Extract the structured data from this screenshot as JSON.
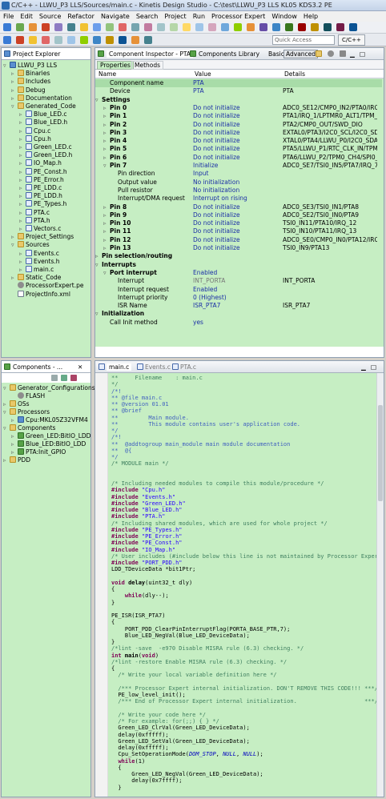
{
  "window": {
    "title": "C/C++ - LLWU_P3 LLS/Sources/main.c - Kinetis Design Studio - C:\\test\\LLWU_P3 LLS KL05 KDS3.2 PE"
  },
  "menu": [
    "File",
    "Edit",
    "Source",
    "Refactor",
    "Navigate",
    "Search",
    "Project",
    "Run",
    "Processor Expert",
    "Window",
    "Help"
  ],
  "toolbar": {
    "quick_access_placeholder": "Quick Access",
    "perspective": "C/C++"
  },
  "project_explorer": {
    "tab_label": "Project Explorer",
    "items": [
      {
        "label": "LLWU_P3 LLS",
        "icon": "project-icon",
        "depth": 0,
        "twisty": "▿"
      },
      {
        "label": "Binaries",
        "icon": "folder-icon",
        "depth": 1,
        "twisty": "▹"
      },
      {
        "label": "Includes",
        "icon": "folder-icon",
        "depth": 1,
        "twisty": "▹"
      },
      {
        "label": "Debug",
        "icon": "folder-icon",
        "depth": 1,
        "twisty": "▹"
      },
      {
        "label": "Documentation",
        "icon": "folder-icon",
        "depth": 1,
        "twisty": "▹"
      },
      {
        "label": "Generated_Code",
        "icon": "folder-icon",
        "depth": 1,
        "twisty": "▿"
      },
      {
        "label": "Blue_LED.c",
        "icon": "c-file-icon",
        "depth": 2,
        "twisty": "▹"
      },
      {
        "label": "Blue_LED.h",
        "icon": "c-file-icon",
        "depth": 2,
        "twisty": "▹"
      },
      {
        "label": "Cpu.c",
        "icon": "c-file-icon",
        "depth": 2,
        "twisty": "▹"
      },
      {
        "label": "Cpu.h",
        "icon": "c-file-icon",
        "depth": 2,
        "twisty": "▹"
      },
      {
        "label": "Green_LED.c",
        "icon": "c-file-icon",
        "depth": 2,
        "twisty": "▹"
      },
      {
        "label": "Green_LED.h",
        "icon": "c-file-icon",
        "depth": 2,
        "twisty": "▹"
      },
      {
        "label": "IO_Map.h",
        "icon": "c-file-icon",
        "depth": 2,
        "twisty": "▹"
      },
      {
        "label": "PE_Const.h",
        "icon": "c-file-icon",
        "depth": 2,
        "twisty": "▹"
      },
      {
        "label": "PE_Error.h",
        "icon": "c-file-icon",
        "depth": 2,
        "twisty": "▹"
      },
      {
        "label": "PE_LDD.c",
        "icon": "c-file-icon",
        "depth": 2,
        "twisty": "▹"
      },
      {
        "label": "PE_LDD.h",
        "icon": "c-file-icon",
        "depth": 2,
        "twisty": "▹"
      },
      {
        "label": "PE_Types.h",
        "icon": "c-file-icon",
        "depth": 2,
        "twisty": "▹"
      },
      {
        "label": "PTA.c",
        "icon": "c-file-icon",
        "depth": 2,
        "twisty": "▹"
      },
      {
        "label": "PTA.h",
        "icon": "c-file-icon",
        "depth": 2,
        "twisty": "▹"
      },
      {
        "label": "Vectors.c",
        "icon": "c-file-icon",
        "depth": 2,
        "twisty": "▹"
      },
      {
        "label": "Project_Settings",
        "icon": "folder-icon",
        "depth": 1,
        "twisty": "▹"
      },
      {
        "label": "Sources",
        "icon": "folder-icon",
        "depth": 1,
        "twisty": "▿"
      },
      {
        "label": "Events.c",
        "icon": "c-file-icon",
        "depth": 2,
        "twisty": "▹"
      },
      {
        "label": "Events.h",
        "icon": "c-file-icon",
        "depth": 2,
        "twisty": "▹"
      },
      {
        "label": "main.c",
        "icon": "c-file-icon",
        "depth": 2,
        "twisty": "▹"
      },
      {
        "label": "Static_Code",
        "icon": "folder-icon",
        "depth": 1,
        "twisty": "▹"
      },
      {
        "label": "ProcessorExpert.pe",
        "icon": "gear-icon",
        "depth": 1,
        "twisty": ""
      },
      {
        "label": "ProjectInfo.xml",
        "icon": "file-icon",
        "depth": 1,
        "twisty": ""
      }
    ]
  },
  "component_inspector": {
    "tab_label": "Component Inspector - PTA",
    "tab2_label": "Components Library",
    "mode_basic": "Basic",
    "mode_advanced": "Advanced",
    "subtabs": [
      "Properties",
      "Methods"
    ],
    "headers": [
      "Name",
      "Value",
      "Details"
    ],
    "rows": [
      {
        "name": "Component name",
        "value": "PTA",
        "details": "",
        "indent": 1,
        "twisty": "",
        "bold": false
      },
      {
        "name": "Device",
        "value": "PTA",
        "details": "PTA",
        "indent": 1,
        "twisty": "",
        "bold": false
      },
      {
        "name": "Settings",
        "value": "",
        "details": "",
        "indent": 0,
        "twisty": "▿",
        "bold": true
      },
      {
        "name": "Pin 0",
        "value": "Do not initialize",
        "details": "ADC0_SE12/CMP0_IN2/PTA0/IRQ_...",
        "indent": 1,
        "twisty": "▹",
        "bold": true
      },
      {
        "name": "Pin 1",
        "value": "Do not initialize",
        "details": "PTA1/IRQ_1/LPTMR0_ALT1/TPM_...",
        "indent": 1,
        "twisty": "▹",
        "bold": true
      },
      {
        "name": "Pin 2",
        "value": "Do not initialize",
        "details": "PTA2/CMP0_OUT/SWD_DIO",
        "indent": 1,
        "twisty": "▹",
        "bold": true
      },
      {
        "name": "Pin 3",
        "value": "Do not initialize",
        "details": "EXTAL0/PTA3/I2C0_SCL/I2C0_SDA",
        "indent": 1,
        "twisty": "▹",
        "bold": true
      },
      {
        "name": "Pin 4",
        "value": "Do not initialize",
        "details": "XTAL0/PTA4/LLWU_P0/I2C0_SDA/...",
        "indent": 1,
        "twisty": "▹",
        "bold": true
      },
      {
        "name": "Pin 5",
        "value": "Do not initialize",
        "details": "PTA5/LLWU_P1/RTC_CLK_IN/TPM...",
        "indent": 1,
        "twisty": "▹",
        "bold": true
      },
      {
        "name": "Pin 6",
        "value": "Do not initialize",
        "details": "PTA6/LLWU_P2/TPM0_CH4/SPI0_...",
        "indent": 1,
        "twisty": "▹",
        "bold": true
      },
      {
        "name": "Pin 7",
        "value": "Initialize",
        "details": "ADC0_SE7/TSI0_IN5/PTA7/IRQ_7/L...",
        "indent": 1,
        "twisty": "▿",
        "bold": true
      },
      {
        "name": "Pin direction",
        "value": "Input",
        "details": "",
        "indent": 2,
        "twisty": "",
        "bold": false
      },
      {
        "name": "Output value",
        "value": "No initialization",
        "details": "",
        "indent": 2,
        "twisty": "",
        "bold": false
      },
      {
        "name": "Pull resistor",
        "value": "No initialization",
        "details": "",
        "indent": 2,
        "twisty": "",
        "bold": false
      },
      {
        "name": "Interrupt/DMA request",
        "value": "Interrupt on rising",
        "details": "",
        "indent": 2,
        "twisty": "",
        "bold": false
      },
      {
        "name": "Pin 8",
        "value": "Do not initialize",
        "details": "ADC0_SE3/TSI0_IN1/PTA8",
        "indent": 1,
        "twisty": "▹",
        "bold": true
      },
      {
        "name": "Pin 9",
        "value": "Do not initialize",
        "details": "ADC0_SE2/TSI0_IN0/PTA9",
        "indent": 1,
        "twisty": "▹",
        "bold": true
      },
      {
        "name": "Pin 10",
        "value": "Do not initialize",
        "details": "TSI0_IN11/PTA10/IRQ_12",
        "indent": 1,
        "twisty": "▹",
        "bold": true
      },
      {
        "name": "Pin 11",
        "value": "Do not initialize",
        "details": "TSI0_IN10/PTA11/IRQ_13",
        "indent": 1,
        "twisty": "▹",
        "bold": true
      },
      {
        "name": "Pin 12",
        "value": "Do not initialize",
        "details": "ADC0_SE0/CMP0_IN0/PTA12/IRQ_...",
        "indent": 1,
        "twisty": "▹",
        "bold": true
      },
      {
        "name": "Pin 13",
        "value": "Do not initialize",
        "details": "TSI0_IN9/PTA13",
        "indent": 1,
        "twisty": "▹",
        "bold": true
      },
      {
        "name": "Pin selection/routing",
        "value": "",
        "details": "",
        "indent": 0,
        "twisty": "▹",
        "bold": true
      },
      {
        "name": "Interrupts",
        "value": "",
        "details": "",
        "indent": 0,
        "twisty": "▿",
        "bold": true
      },
      {
        "name": "Port interrupt",
        "value": "Enabled",
        "details": "",
        "indent": 1,
        "twisty": "▿",
        "bold": true
      },
      {
        "name": "Interrupt",
        "value": "INT_PORTA",
        "details": "INT_PORTA",
        "indent": 2,
        "twisty": "",
        "bold": false,
        "gray": true
      },
      {
        "name": "Interrupt request",
        "value": "Enabled",
        "details": "",
        "indent": 2,
        "twisty": "",
        "bold": false
      },
      {
        "name": "Interrupt priority",
        "value": "0 (Highest)",
        "details": "",
        "indent": 2,
        "twisty": "",
        "bold": false
      },
      {
        "name": "ISR Name",
        "value": "ISR_PTA7",
        "details": "ISR_PTA7",
        "indent": 2,
        "twisty": "",
        "bold": false
      },
      {
        "name": "Initialization",
        "value": "",
        "details": "",
        "indent": 0,
        "twisty": "▿",
        "bold": true
      },
      {
        "name": "Call Init method",
        "value": "yes",
        "details": "",
        "indent": 1,
        "twisty": "",
        "bold": false
      }
    ]
  },
  "components": {
    "tab_label": "Components - ...",
    "items": [
      {
        "label": "Generator_Configurations",
        "icon": "folder-icon",
        "depth": 0,
        "twisty": "▿"
      },
      {
        "label": "FLASH",
        "icon": "gear-icon",
        "depth": 1,
        "twisty": ""
      },
      {
        "label": "OSs",
        "icon": "folder-icon",
        "depth": 0,
        "twisty": "▹"
      },
      {
        "label": "Processors",
        "icon": "folder-icon",
        "depth": 0,
        "twisty": "▿"
      },
      {
        "label": "Cpu:MKL05Z32VFM4",
        "icon": "cpu-icon",
        "depth": 1,
        "twisty": "▹"
      },
      {
        "label": "Components",
        "icon": "folder-icon",
        "depth": 0,
        "twisty": "▿"
      },
      {
        "label": "Green_LED:BitIO_LDD",
        "icon": "component-icon",
        "depth": 1,
        "twisty": "▹"
      },
      {
        "label": "Blue_LED:BitIO_LDD",
        "icon": "component-icon",
        "depth": 1,
        "twisty": "▹"
      },
      {
        "label": "PTA:Init_GPIO",
        "icon": "component-icon",
        "depth": 1,
        "twisty": "▹"
      },
      {
        "label": "PDD",
        "icon": "folder-icon",
        "depth": 0,
        "twisty": "▹"
      }
    ]
  },
  "editor": {
    "tabs": [
      "main.c",
      "Events.c",
      "PTA.c"
    ],
    "lines": [
      {
        "t": "**     Filename    : main.c",
        "c": "cm"
      },
      {
        "t": "*/",
        "c": "cm"
      },
      {
        "t": "/*!",
        "c": "doc"
      },
      {
        "t": "** @file main.c",
        "c": "doc"
      },
      {
        "t": "** @version 01.01",
        "c": "doc"
      },
      {
        "t": "** @brief",
        "c": "doc"
      },
      {
        "t": "**         Main module.",
        "c": "doc"
      },
      {
        "t": "**         This module contains user's application code.",
        "c": "doc"
      },
      {
        "t": "*/",
        "c": "doc"
      },
      {
        "t": "/*!",
        "c": "doc"
      },
      {
        "t": "**  @addtogroup main_module main module documentation",
        "c": "doc"
      },
      {
        "t": "**  @{",
        "c": "doc"
      },
      {
        "t": "*/",
        "c": "doc"
      },
      {
        "t": "/* MODULE main */",
        "c": "cm"
      },
      {
        "t": "",
        "c": ""
      },
      {
        "t": "",
        "c": ""
      },
      {
        "t": "/* Including needed modules to compile this module/procedure */",
        "c": "cm"
      },
      {
        "t": "#include \"Cpu.h\"",
        "c": "inc"
      },
      {
        "t": "#include \"Events.h\"",
        "c": "inc"
      },
      {
        "t": "#include \"Green_LED.h\"",
        "c": "inc"
      },
      {
        "t": "#include \"Blue_LED.h\"",
        "c": "inc"
      },
      {
        "t": "#include \"PTA.h\"",
        "c": "inc"
      },
      {
        "t": "/* Including shared modules, which are used for whole project */",
        "c": "cm"
      },
      {
        "t": "#include \"PE_Types.h\"",
        "c": "inc"
      },
      {
        "t": "#include \"PE_Error.h\"",
        "c": "inc"
      },
      {
        "t": "#include \"PE_Const.h\"",
        "c": "inc"
      },
      {
        "t": "#include \"IO_Map.h\"",
        "c": "inc"
      },
      {
        "t": "/* User includes (#include below this line is not maintained by Processor Expert) */",
        "c": "cm"
      },
      {
        "t": "#include \"PORT_PDD.h\"",
        "c": "inc"
      },
      {
        "t": "LDD_TDeviceData *bit1Ptr;",
        "c": ""
      },
      {
        "t": "",
        "c": ""
      },
      {
        "t": "void delay(uint32_t dly)",
        "c": "fn"
      },
      {
        "t": "{",
        "c": ""
      },
      {
        "t": "    while(dly--);",
        "c": "kwl"
      },
      {
        "t": "}",
        "c": ""
      },
      {
        "t": "",
        "c": ""
      },
      {
        "t": "PE_ISR(ISR_PTA7)",
        "c": ""
      },
      {
        "t": "{",
        "c": ""
      },
      {
        "t": "    PORT_PDD_ClearPinInterruptFlag(PORTA_BASE_PTR,7);",
        "c": ""
      },
      {
        "t": "    Blue_LED_NegVal(Blue_LED_DeviceData);",
        "c": ""
      },
      {
        "t": "}",
        "c": ""
      },
      {
        "t": "/*lint -save  -e970 Disable MISRA rule (6.3) checking. */",
        "c": "cm"
      },
      {
        "t": "int main(void)",
        "c": "fn"
      },
      {
        "t": "/*lint -restore Enable MISRA rule (6.3) checking. */",
        "c": "cm"
      },
      {
        "t": "{",
        "c": ""
      },
      {
        "t": "  /* Write your local variable definition here */",
        "c": "cm"
      },
      {
        "t": "",
        "c": ""
      },
      {
        "t": "  /*** Processor Expert internal initialization. DON'T REMOVE THIS CODE!!! ***/",
        "c": "cm"
      },
      {
        "t": "  PE_low_level_init();",
        "c": ""
      },
      {
        "t": "  /*** End of Processor Expert internal initialization.                    ***/",
        "c": "cm"
      },
      {
        "t": "",
        "c": ""
      },
      {
        "t": "  /* Write your code here */",
        "c": "cm"
      },
      {
        "t": "  /* For example: for(;;) { } */",
        "c": "cm"
      },
      {
        "t": "  Green_LED_ClrVal(Green_LED_DeviceData);",
        "c": ""
      },
      {
        "t": "  delay(0xfffff);",
        "c": ""
      },
      {
        "t": "  Green_LED_SetVal(Green_LED_DeviceData);",
        "c": ""
      },
      {
        "t": "  delay(0xfffff);",
        "c": ""
      },
      {
        "t": "  Cpu_SetOperationMode(DOM_STOP, NULL, NULL);",
        "c": ""
      },
      {
        "t": "  while(1)",
        "c": "kwl"
      },
      {
        "t": "  {",
        "c": ""
      },
      {
        "t": "      Green_LED_NegVal(Green_LED_DeviceData);",
        "c": ""
      },
      {
        "t": "      delay(0x7ffff);",
        "c": ""
      },
      {
        "t": "  }",
        "c": ""
      }
    ]
  },
  "colors": {
    "green_bg": "#c6eec3",
    "link": "#1a2ea6"
  }
}
